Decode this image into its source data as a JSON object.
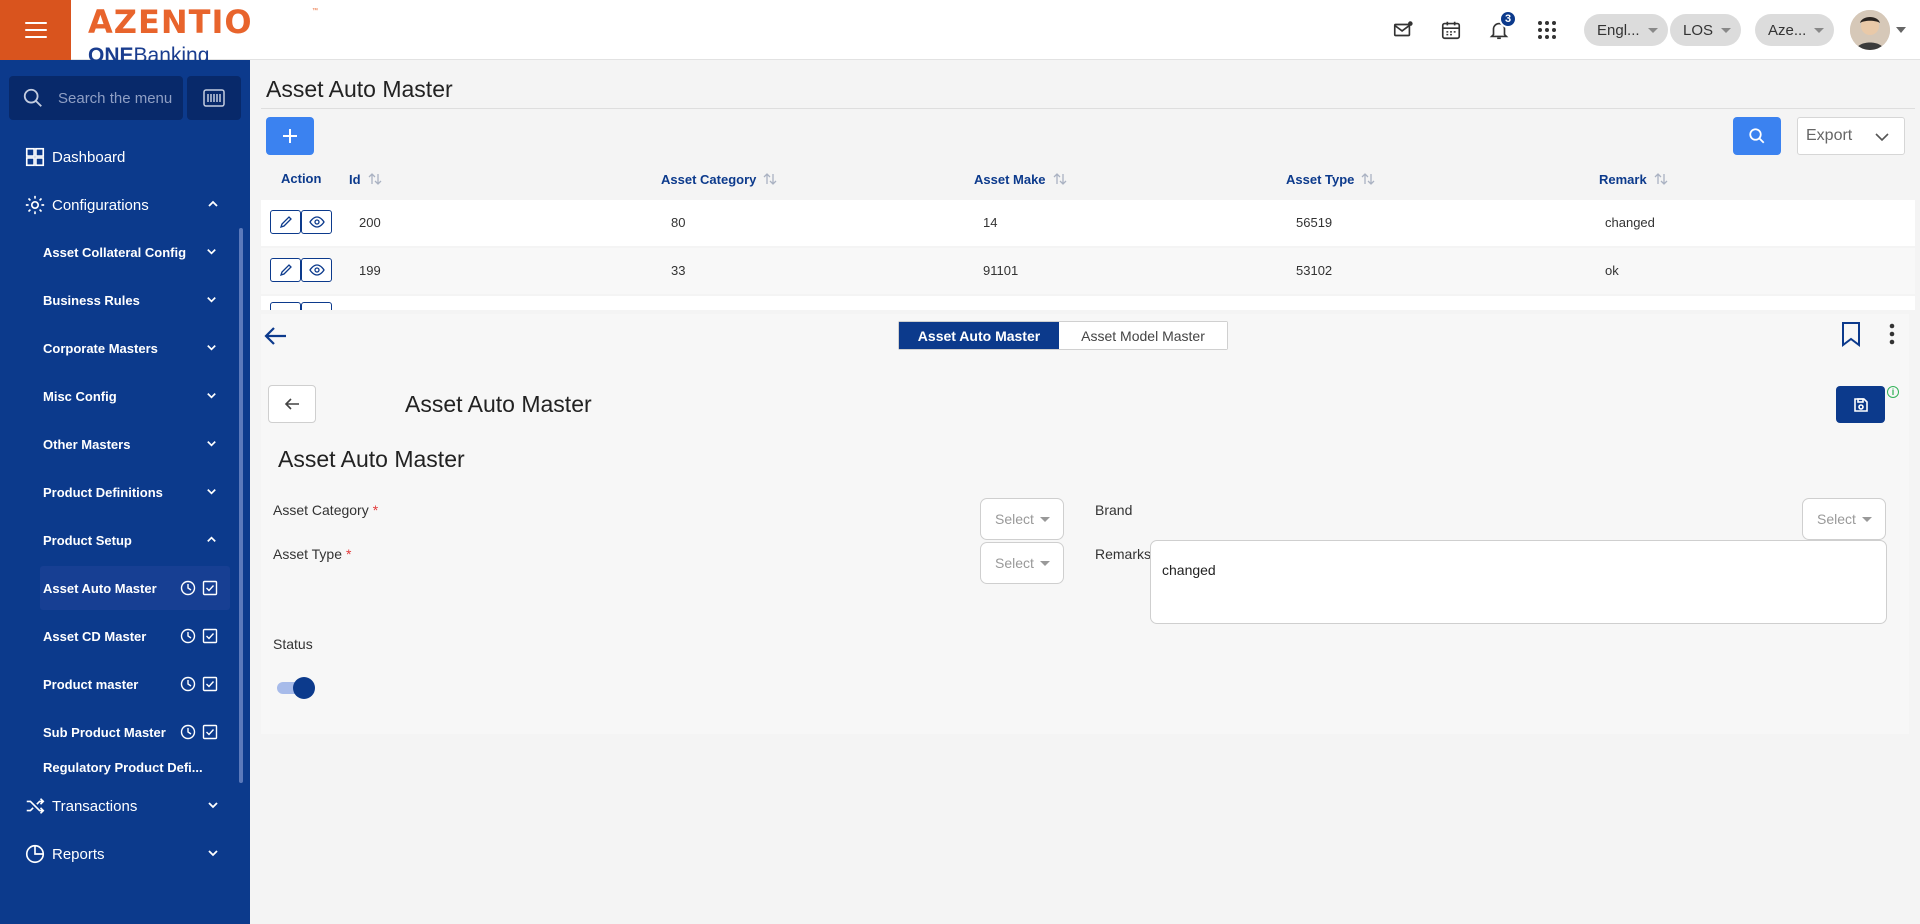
{
  "header": {
    "logo_brand": "AZENTIO",
    "logo_tm": "™",
    "logo_sub_bold": "ONE",
    "logo_sub_rest": "Banking",
    "notification_count": "3",
    "language": "Engl...",
    "module": "LOS",
    "entity": "Aze...",
    "icons": [
      "menu-icon",
      "mail-icon",
      "calendar-icon",
      "bell-icon",
      "apps-grid-icon"
    ]
  },
  "sidebar": {
    "search_placeholder": "Search the menu",
    "dashboard": "Dashboard",
    "configurations": "Configurations",
    "groups": [
      "Asset Collateral Config",
      "Business Rules",
      "Corporate Masters",
      "Misc Config",
      "Other Masters",
      "Product Definitions",
      "Product Setup"
    ],
    "leaves": [
      "Asset Auto Master",
      "Asset CD Master",
      "Product master",
      "Sub Product Master"
    ],
    "cut_group": "Regulatory Product Defi...",
    "transactions": "Transactions",
    "reports": "Reports",
    "colors": {
      "sidebar_bg": "#0c3a8c",
      "accent": "#d9541e"
    }
  },
  "list": {
    "title": "Asset Auto Master",
    "export_label": "Export",
    "columns": [
      "Action",
      "Id",
      "Asset Category",
      "Asset Make",
      "Asset Type",
      "Remark"
    ],
    "rows": [
      {
        "id": "200",
        "category": "80",
        "make": "14",
        "type": "56519",
        "remark": "changed"
      },
      {
        "id": "199",
        "category": "33",
        "make": "91101",
        "type": "53102",
        "remark": "ok"
      }
    ]
  },
  "detail": {
    "tabs": [
      "Asset Auto Master",
      "Asset Model Master"
    ],
    "form_title": "Asset Auto Master",
    "section_title": "Asset Auto Master",
    "fields": {
      "asset_category_label": "Asset Category",
      "asset_type_label": "Asset Type",
      "brand_label": "Brand",
      "remarks_label": "Remarks",
      "required_mark": "*",
      "select_placeholder": "Select",
      "remarks_value": "changed",
      "status_label": "Status",
      "status_on": true
    },
    "info_glyph": "i"
  }
}
